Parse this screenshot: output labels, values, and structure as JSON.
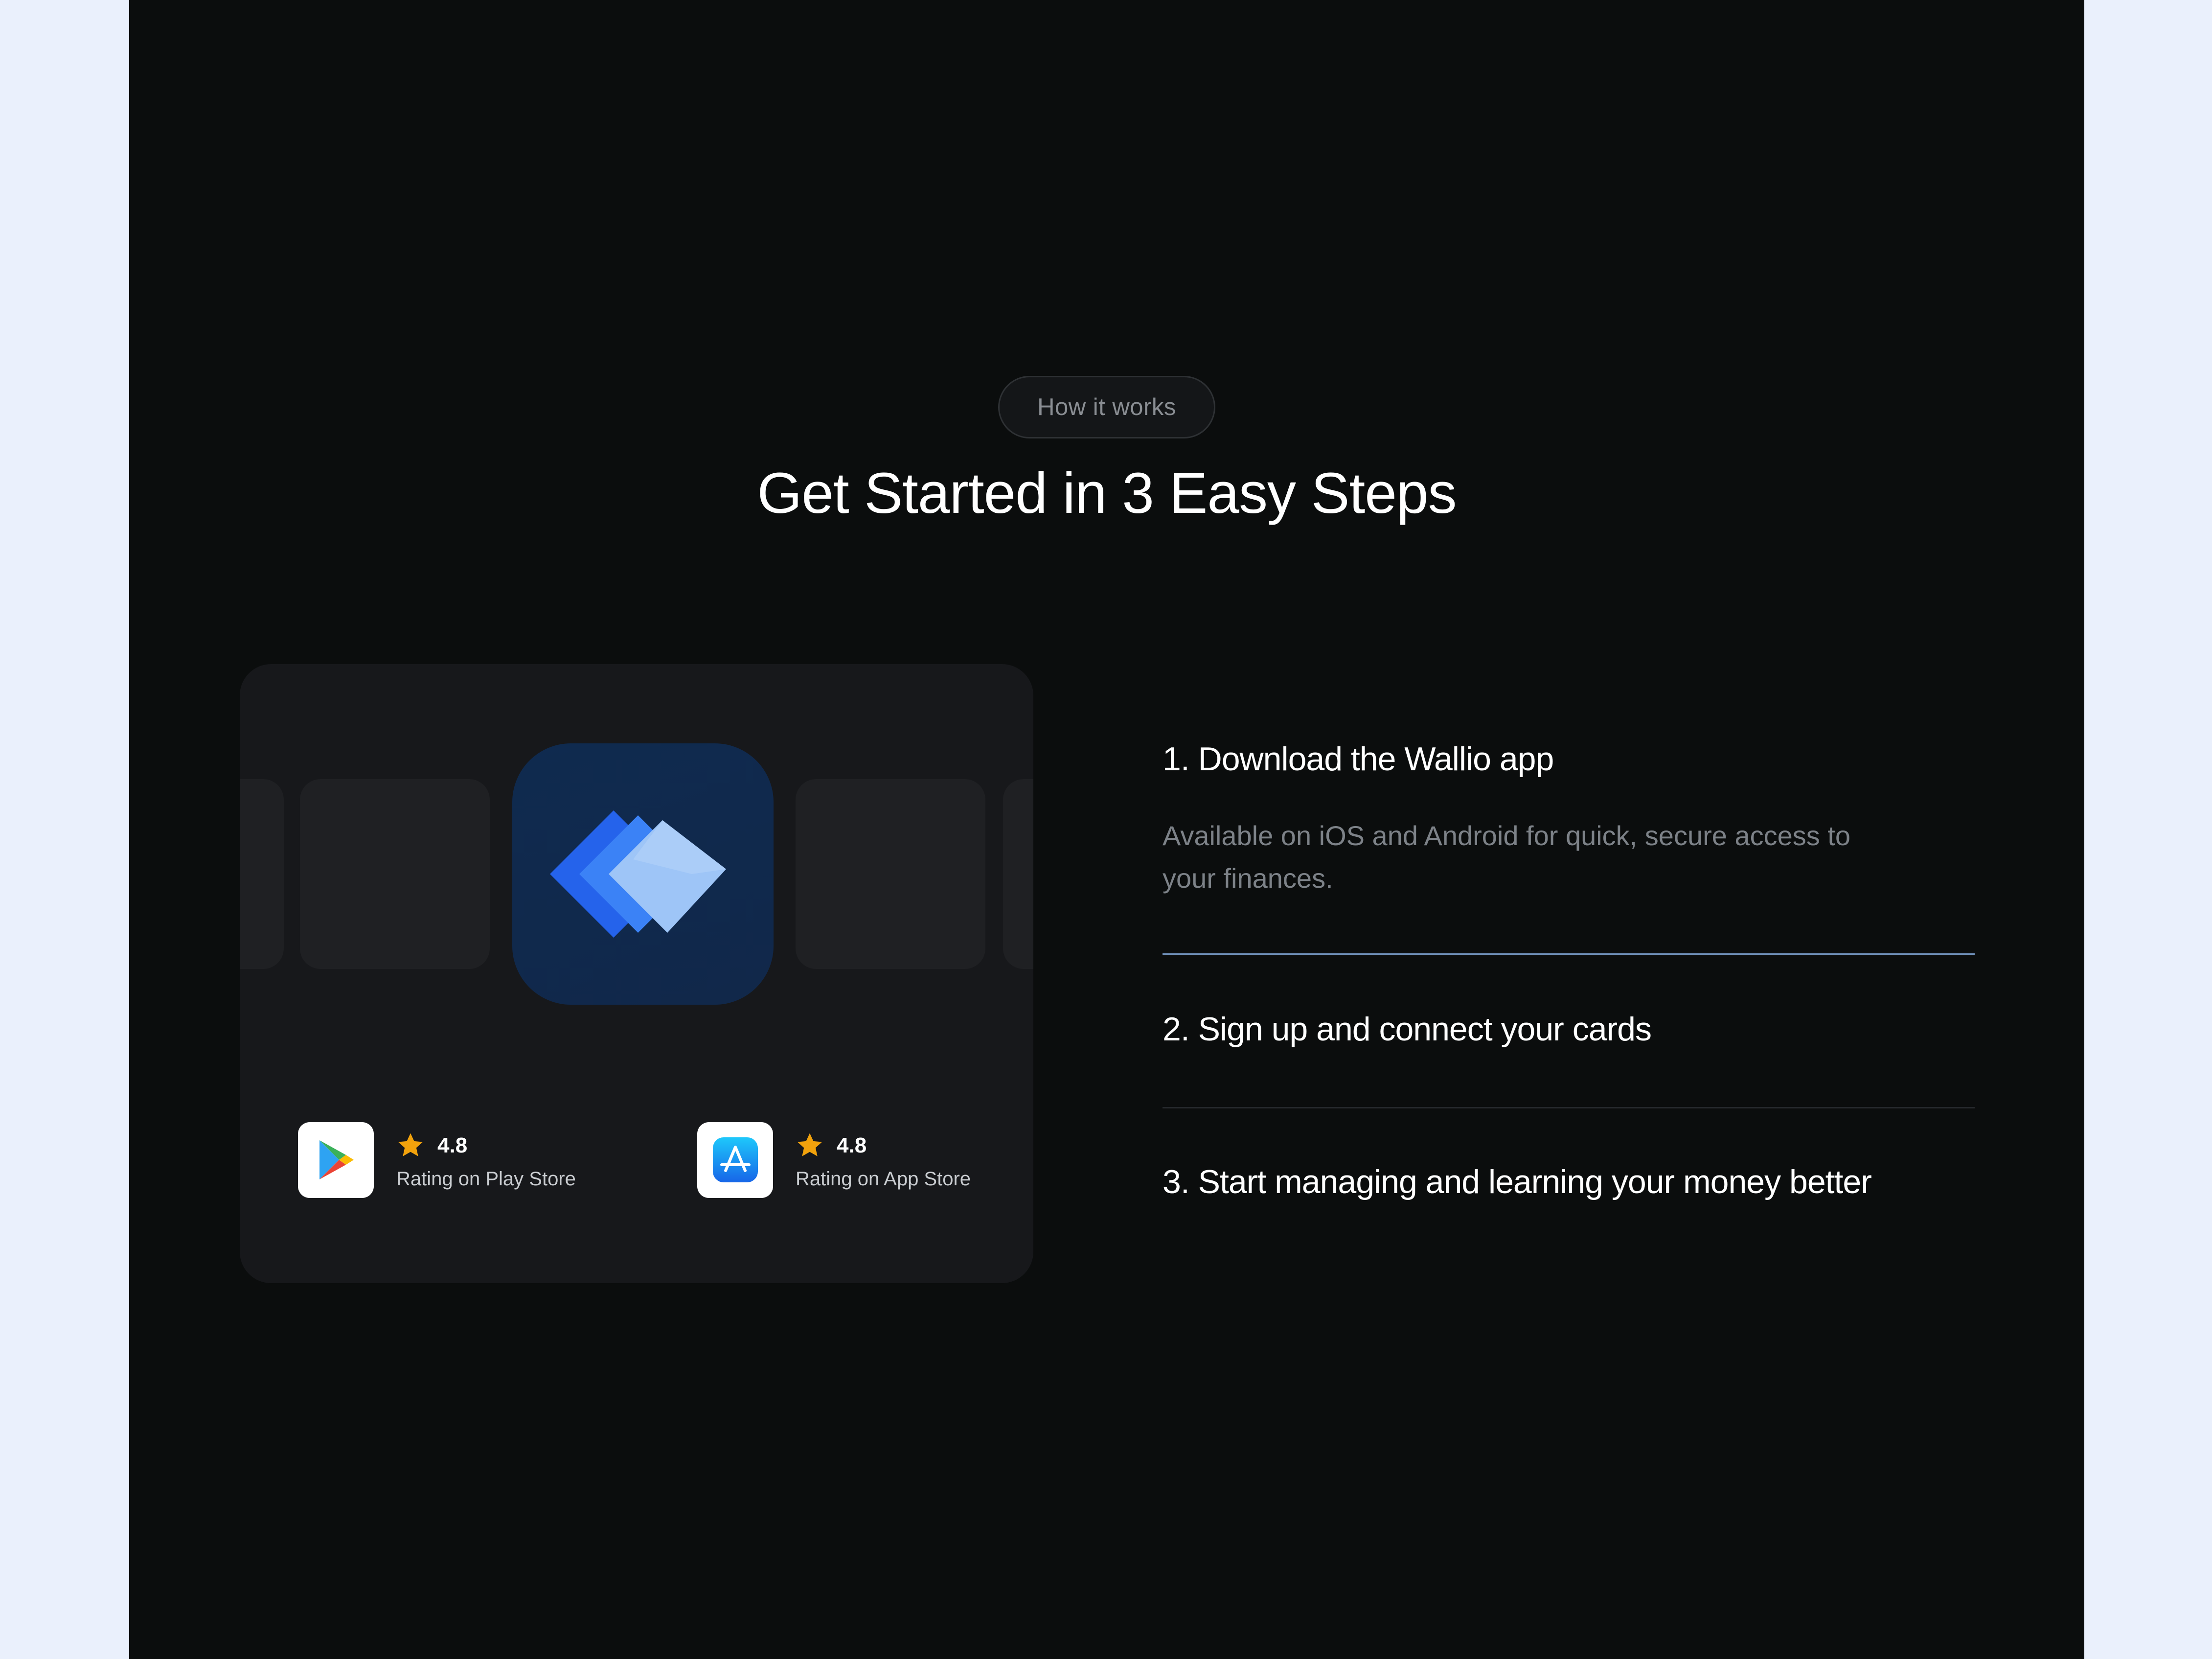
{
  "section": {
    "badge": "How it works",
    "heading": "Get Started in 3 Easy Steps"
  },
  "stores": [
    {
      "rating": "4.8",
      "label": "Rating on Play Store",
      "icon": "google-play-icon"
    },
    {
      "rating": "4.8",
      "label": "Rating on App Store",
      "icon": "app-store-icon"
    }
  ],
  "steps": [
    {
      "title": "1. Download the Wallio app",
      "description": "Available on iOS and Android for quick, secure access to your finances."
    },
    {
      "title": "2. Sign up and connect your cards"
    },
    {
      "title": "3. Start managing and learning your money better"
    }
  ],
  "colors": {
    "background": "#0b0d0d",
    "card": "#17181b",
    "accent_rule": "#6f8fb8",
    "star": "#f2a20c",
    "logo_blue": "#2563eb"
  }
}
